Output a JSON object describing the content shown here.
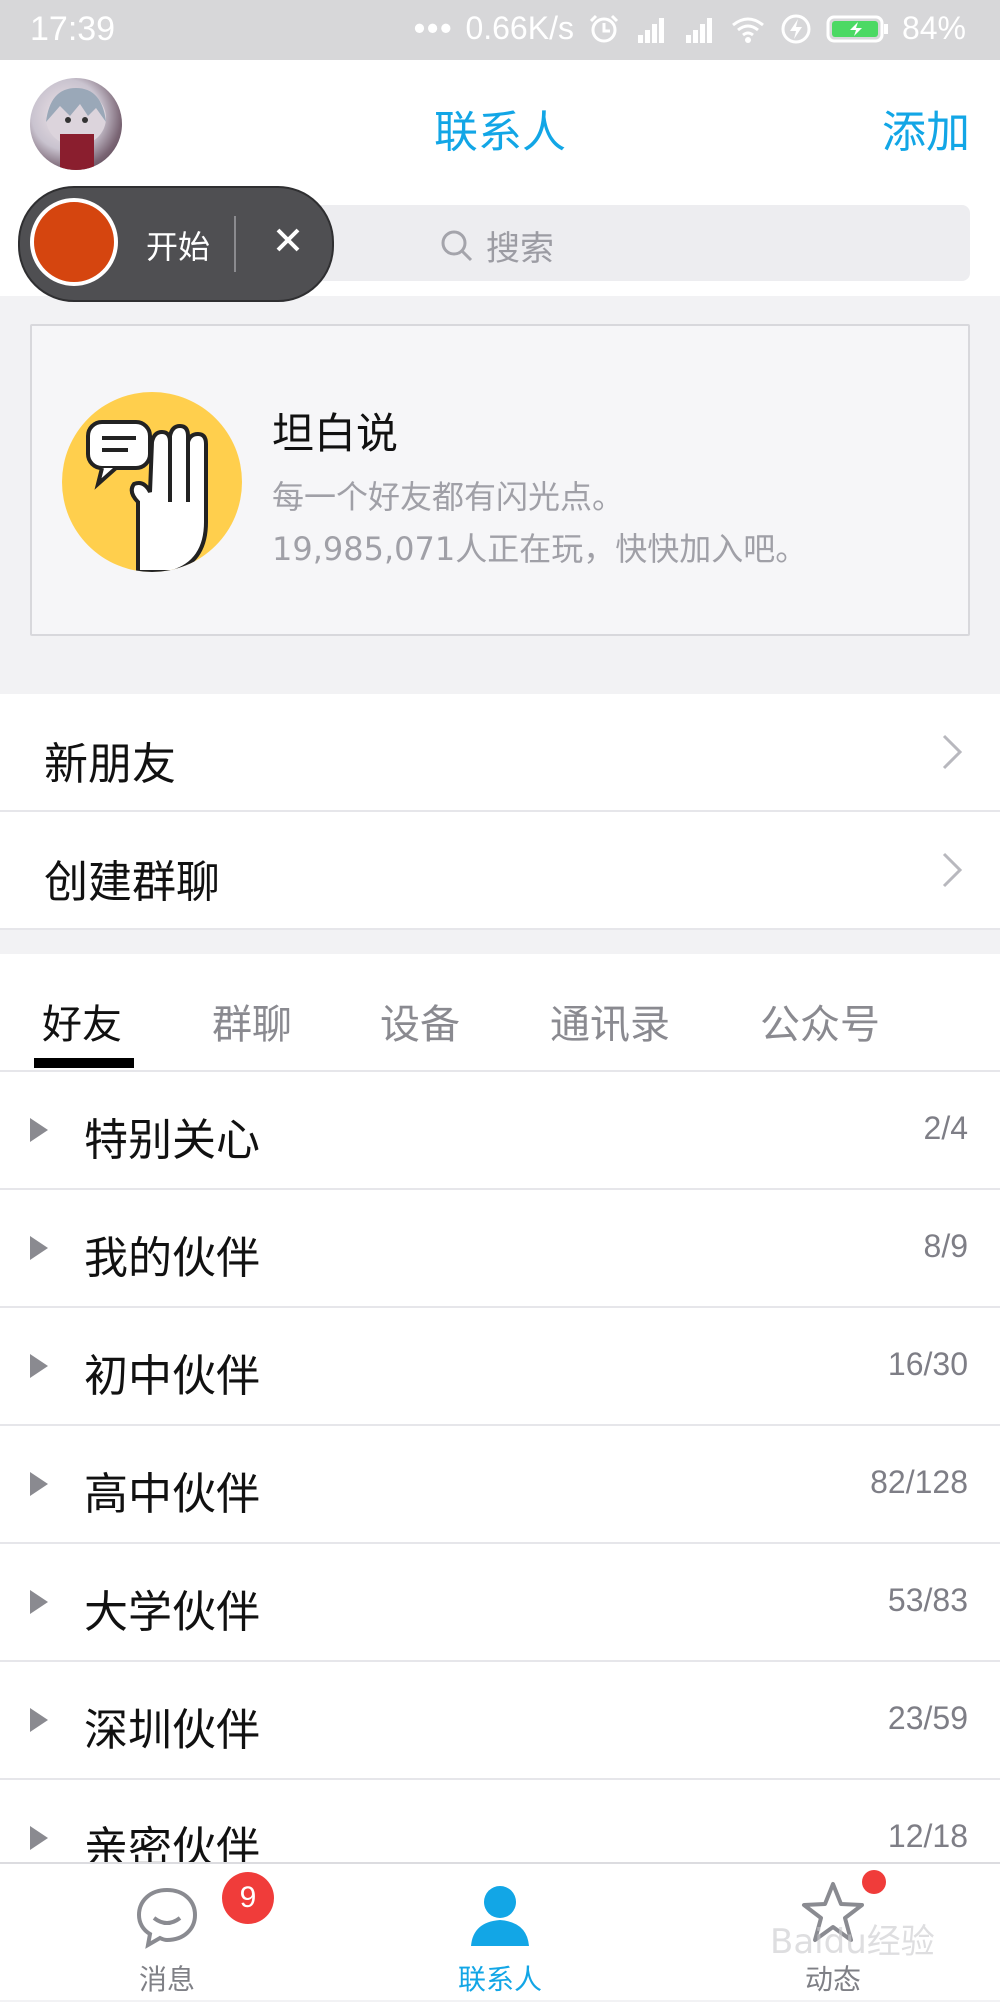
{
  "status_bar": {
    "time": "17:39",
    "speed": "0.66K/s",
    "battery": "84%",
    "icons": [
      "dots-icon",
      "alarm-icon",
      "signal-icon",
      "signal-icon",
      "wifi-icon",
      "charging-icon",
      "battery-icon"
    ]
  },
  "header": {
    "title": "联系人",
    "add_label": "添加"
  },
  "overlay": {
    "start_label": "开始"
  },
  "search": {
    "placeholder": "搜索"
  },
  "card": {
    "title": "坦白说",
    "subtitle1": "每一个好友都有闪光点。",
    "subtitle2": "19,985,071人正在玩，快快加入吧。"
  },
  "list": [
    {
      "label": "新朋友"
    },
    {
      "label": "创建群聊"
    }
  ],
  "tabs": [
    {
      "label": "好友"
    },
    {
      "label": "群聊"
    },
    {
      "label": "设备"
    },
    {
      "label": "通讯录"
    },
    {
      "label": "公众号"
    }
  ],
  "groups": [
    {
      "name": "特别关心",
      "count": "2/4"
    },
    {
      "name": "我的伙伴",
      "count": "8/9"
    },
    {
      "name": "初中伙伴",
      "count": "16/30"
    },
    {
      "name": "高中伙伴",
      "count": "82/128"
    },
    {
      "name": "大学伙伴",
      "count": "53/83"
    },
    {
      "name": "深圳伙伴",
      "count": "23/59"
    },
    {
      "name": "亲密伙伴",
      "count": "12/18"
    }
  ],
  "bottom_nav": {
    "items": [
      {
        "label": "消息",
        "badge": "9"
      },
      {
        "label": "联系人"
      },
      {
        "label": "动态"
      }
    ]
  },
  "watermark": "Baidu经验",
  "colors": {
    "accent": "#12a6e6",
    "badge": "#f03c3a",
    "overlay_dot": "#d5450f"
  }
}
